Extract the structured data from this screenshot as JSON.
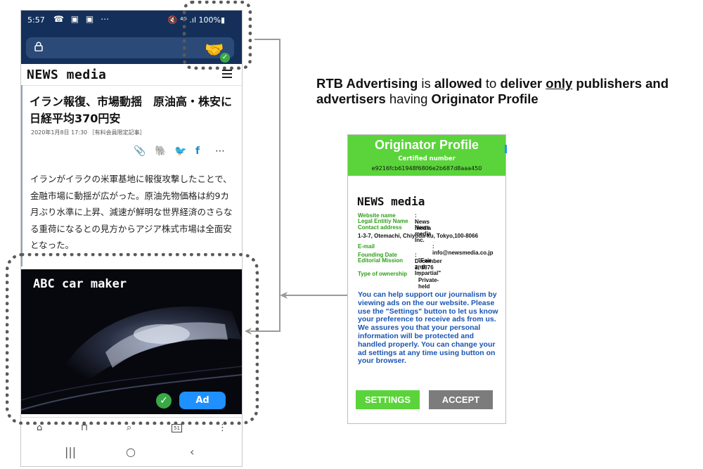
{
  "status_bar": {
    "time": "5:57",
    "icons": "☎ ▣ ▣ ⋯",
    "right": "🔇 ⁴ᴳ .ıl 100%▮"
  },
  "site": {
    "logo": "NEWS media"
  },
  "article": {
    "headline": "イラン報復、市場動揺　原油高・株安に　日経平均370円安",
    "meta": "2020年1月8日 17:30 ［有料会員限定記事］",
    "body": "イランがイラクの米軍基地に報復攻撃したことで、金融市場に動揺が広がった。原油先物価格は約9カ月ぶり水準に上昇、減速が鮮明な世界経済のさらなる重荷になるとの見方からアジア株式市場は全面安となった。"
  },
  "ad": {
    "title": "ABC car maker",
    "button_label": "Ad"
  },
  "bottom_nav": {
    "tab_count": "51"
  },
  "explanation": {
    "p1": "RTB Advertising",
    "p2": " is ",
    "p3": "allowed",
    "p4": " to ",
    "p5": "deliver ",
    "p6": "only",
    "p7": " publishers and advertisers",
    "p8": " having ",
    "p9": "Originator Profile"
  },
  "originator_profile": {
    "title": "Originator Profile",
    "certified_label": "Certified number",
    "certified_number": "e9216fcb61948f6806e2b687d8aaa450",
    "logo": "NEWS media",
    "fields": {
      "website_name_k": "Website name",
      "website_name_v": ": News media",
      "legal_name_k": "Legal Entitiy Name",
      "legal_name_v": ": News media Inc.",
      "contact_k": "Contact address",
      "contact_v": ":",
      "address": "1-3-7, Otemachi, Chiyoda-ku, Tokyo,100-8066",
      "email_k": "E-mail",
      "email_v": ": info@newsmedia.co.jp",
      "founding_k": "Founding Date",
      "founding_v": ": December 2, 1876",
      "mission_k": "Editorial Mission",
      "mission_v": ": \"Fair and Impartial\"",
      "ownership_k": "Type of ownership",
      "ownership_v": ": Private-held"
    },
    "message": "You can help support our journalism by viewing ads on the our website. Please use the \"Settings\" button to let us know your preference to receive ads from us. We assures you that your personal information will be protected and handled properly. You can change your ad settings at any time using button on your browser.",
    "settings_label": "SETTINGS",
    "accept_label": "ACCEPT"
  },
  "colors": {
    "brand_green": "#5ad43a",
    "ad_blue": "#1e90ff",
    "header_navy": "#14305a",
    "message_blue": "#1a55b3"
  }
}
